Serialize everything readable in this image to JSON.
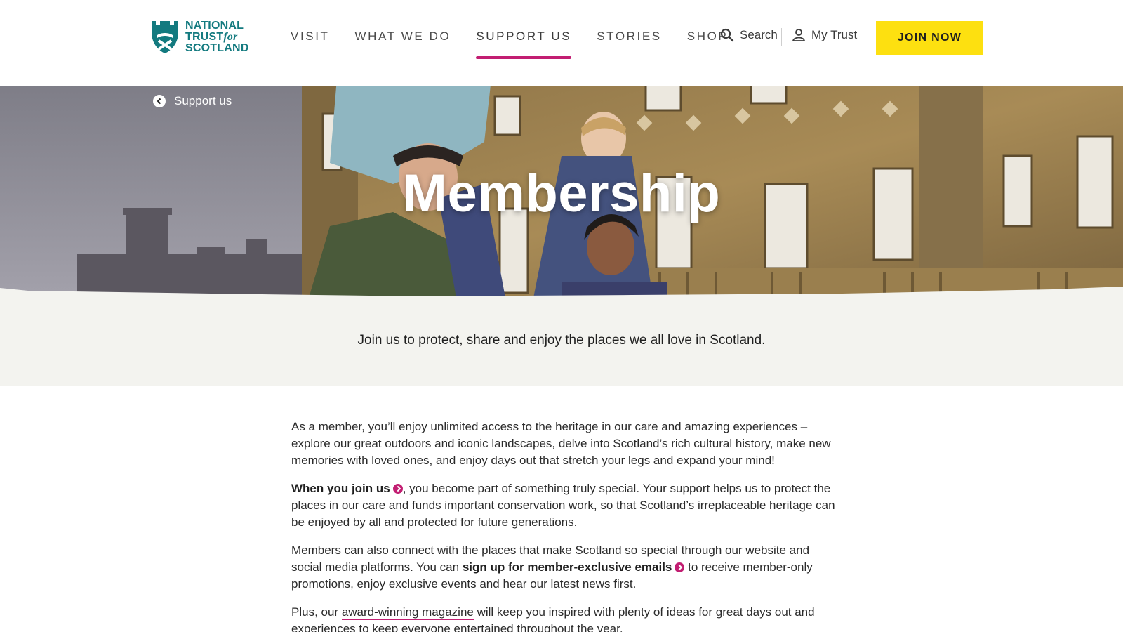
{
  "header": {
    "logo": {
      "line1": "NATIONAL",
      "line2_a": "TRUST",
      "line2_b": "for",
      "line3": "SCOTLAND"
    },
    "nav": [
      {
        "label": "VISIT"
      },
      {
        "label": "WHAT WE DO"
      },
      {
        "label": "SUPPORT US",
        "active": true
      },
      {
        "label": "STORIES"
      },
      {
        "label": "SHOP"
      }
    ],
    "search_label": "Search",
    "mytrust_label": "My Trust",
    "join_label": "JOIN NOW"
  },
  "hero": {
    "breadcrumb": "Support us",
    "title": "Membership"
  },
  "intro": {
    "text": "Join us to protect, share and enjoy the places we all love in Scotland."
  },
  "body": {
    "p1": "As a member, you’ll enjoy unlimited access to the heritage in our care and amazing experiences – explore our great outdoors and iconic landscapes, delve into Scotland’s rich cultural history, make new memories with loved ones, and enjoy days out that stretch your legs and expand your mind!",
    "p2_link": "When you join us",
    "p2_rest": ", you become part of something truly special. Your support helps us to protect the places in our care and funds important conservation work, so that Scotland’s irreplaceable heritage can be enjoyed by all and protected for future generations.",
    "p3_start": "Members can also connect with the places that make Scotland so special through our website and social media platforms. You can ",
    "p3_link": "sign up for member-exclusive emails",
    "p3_end": " to receive member-only promotions, enjoy exclusive events and hear our latest news first.",
    "p4_start": "Plus, our ",
    "p4_link": "award-winning magazine",
    "p4_end": " will keep you inspired with plenty of ideas for great days out and experiences to keep everyone entertained throughout the year."
  },
  "colors": {
    "brand_teal": "#137a7f",
    "accent_pink": "#c21e72",
    "join_yellow": "#fde010",
    "intro_bg": "#f3f3ef"
  }
}
